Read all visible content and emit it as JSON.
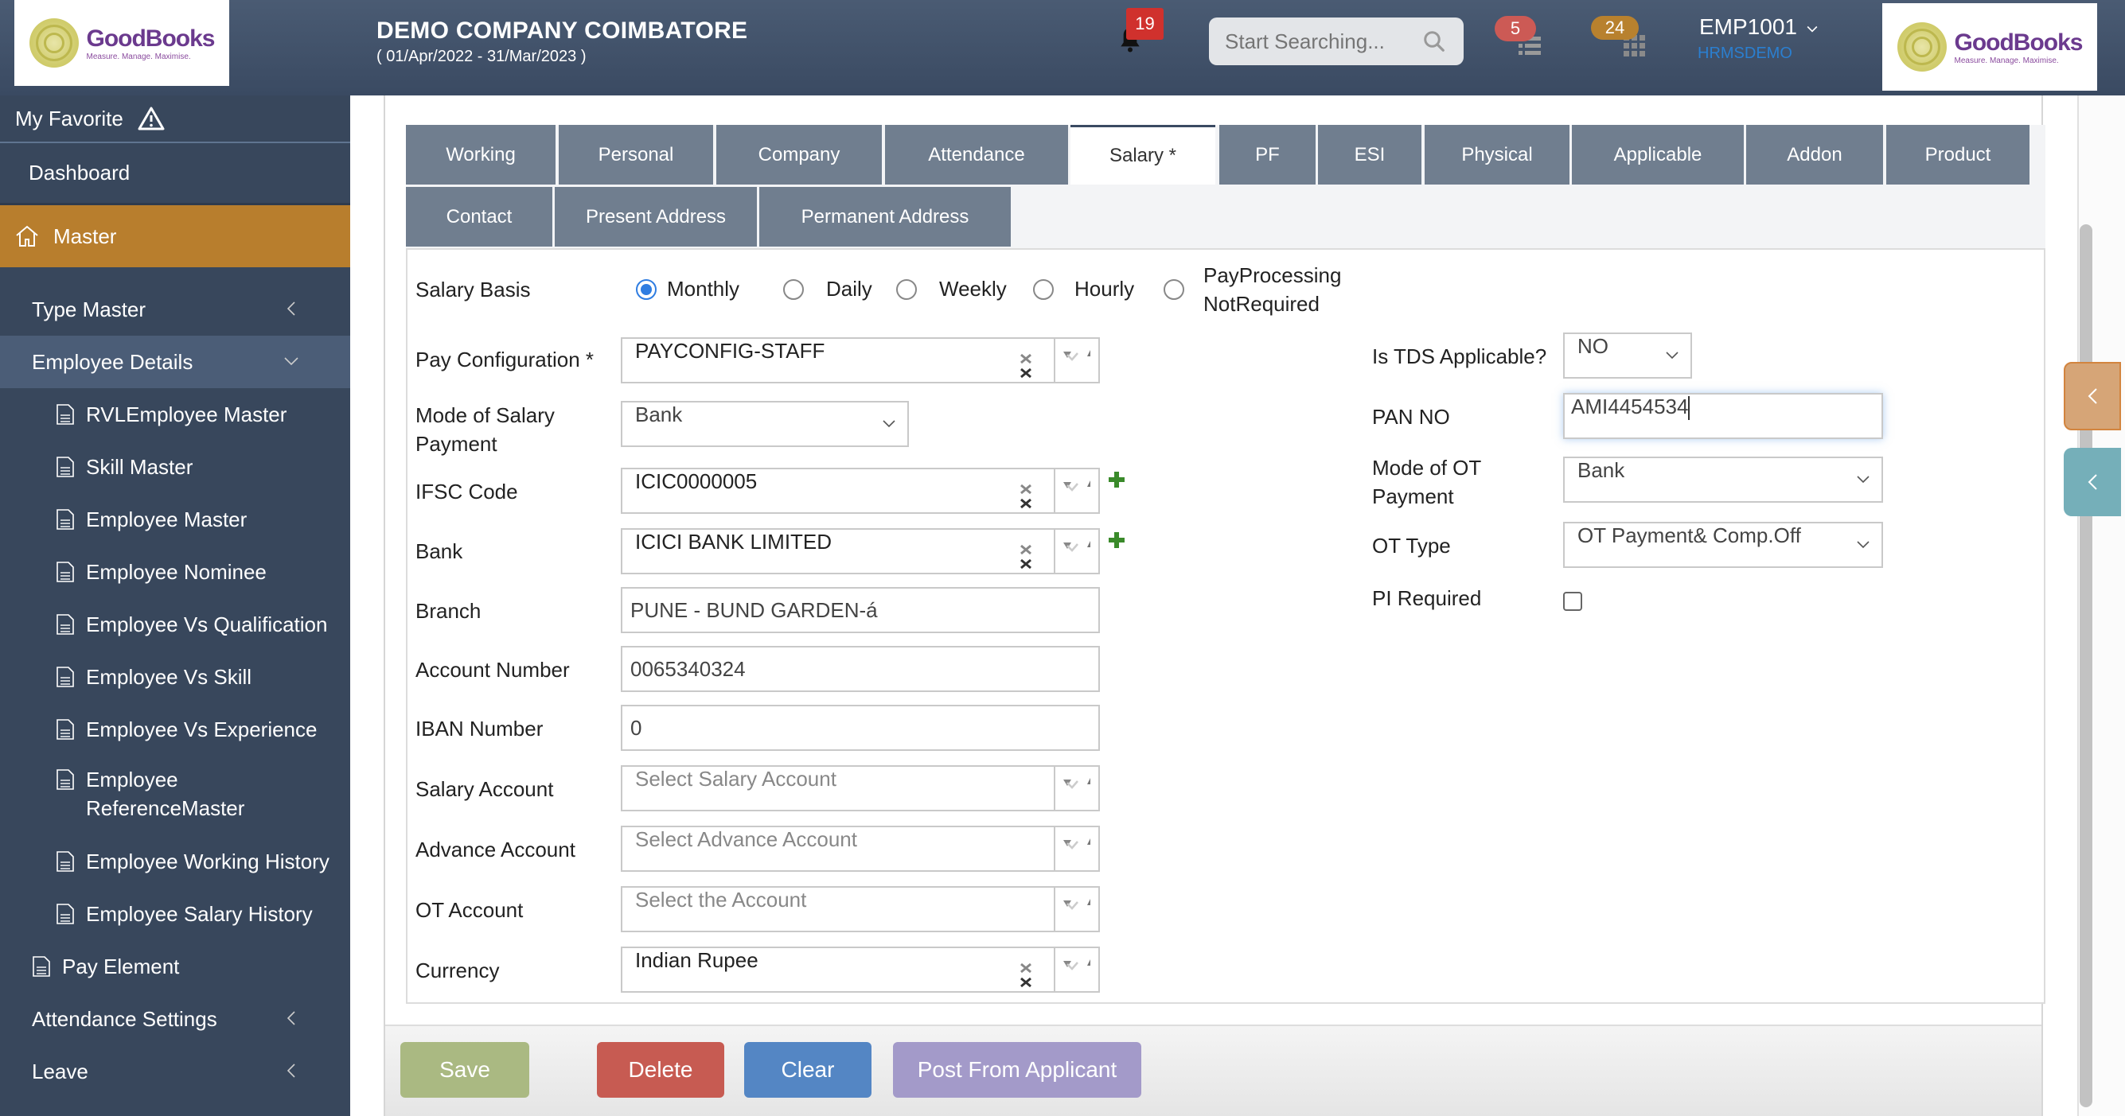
{
  "header": {
    "logo_name": "GoodBooks",
    "logo_tagline": "Measure. Manage. Maximise.",
    "company_name": "DEMO COMPANY COIMBATORE",
    "company_period": "( 01/Apr/2022 - 31/Mar/2023 )",
    "notification_count": "19",
    "search_placeholder": "Start Searching...",
    "tasks_count": "5",
    "apps_count": "24",
    "user_id": "EMP1001",
    "user_sub": "HRMSDEMO"
  },
  "sidebar": {
    "favorite": "My Favorite",
    "dashboard": "Dashboard",
    "master": "Master",
    "groups": [
      {
        "label": "Type Master"
      },
      {
        "label": "Employee Details"
      }
    ],
    "employee_items": [
      {
        "label": "RVLEmployee Master"
      },
      {
        "label": "Skill Master"
      },
      {
        "label": "Employee Master"
      },
      {
        "label": "Employee Nominee"
      },
      {
        "label": "Employee Vs Qualification"
      },
      {
        "label": "Employee Vs Skill"
      },
      {
        "label": "Employee Vs Experience"
      },
      {
        "label": "Employee ReferenceMaster"
      },
      {
        "label": "Employee Working History"
      },
      {
        "label": "Employee Salary History"
      }
    ],
    "pay_element": "Pay Element",
    "attendance_settings": "Attendance Settings",
    "leave": "Leave"
  },
  "tabs": {
    "row1": [
      "Working",
      "Personal",
      "Company",
      "Attendance",
      "Salary *",
      "PF",
      "ESI",
      "Physical",
      "Applicable",
      "Addon",
      "Product"
    ],
    "row2": [
      "Contact",
      "Present Address",
      "Permanent Address"
    ],
    "active": "Salary *"
  },
  "form": {
    "salary_basis": {
      "label": "Salary Basis",
      "options": [
        "Monthly",
        "Daily",
        "Weekly",
        "Hourly",
        "PayProcessing NotRequired"
      ],
      "option_last_line1": "PayProcessing",
      "option_last_line2": "NotRequired",
      "selected": "Monthly"
    },
    "pay_configuration": {
      "label": "Pay Configuration *",
      "value": "PAYCONFIG-STAFF"
    },
    "mode_of_salary_payment": {
      "label_line1": "Mode of Salary",
      "label_line2": "Payment",
      "value": "Bank"
    },
    "ifsc_code": {
      "label": "IFSC Code",
      "value": "ICIC0000005"
    },
    "bank": {
      "label": "Bank",
      "value": "ICICI BANK LIMITED"
    },
    "branch": {
      "label": "Branch",
      "value": "PUNE - BUND GARDEN-á"
    },
    "account_number": {
      "label": "Account Number",
      "value": "0065340324"
    },
    "iban_number": {
      "label": "IBAN Number",
      "value": "0"
    },
    "salary_account": {
      "label": "Salary Account",
      "placeholder": "Select Salary Account"
    },
    "advance_account": {
      "label": "Advance Account",
      "placeholder": "Select Advance Account"
    },
    "ot_account": {
      "label": "OT Account",
      "placeholder": "Select the Account"
    },
    "currency": {
      "label": "Currency",
      "value": "Indian Rupee"
    },
    "is_tds_applicable": {
      "label": "Is TDS Applicable?",
      "value": "NO"
    },
    "pan_no": {
      "label": "PAN NO",
      "value": "AMI4454534"
    },
    "mode_of_ot_payment": {
      "label_line1": "Mode of OT",
      "label_line2": "Payment",
      "value": "Bank"
    },
    "ot_type": {
      "label": "OT Type",
      "value": "OT Payment& Comp.Off"
    },
    "pi_required": {
      "label": "PI Required",
      "checked": false
    }
  },
  "buttons": {
    "save": "Save",
    "delete": "Delete",
    "clear": "Clear",
    "post_from_applicant": "Post From Applicant"
  },
  "colors": {
    "header_bg": "#3f4f67",
    "sidebar_bg": "#38475c",
    "active_menu": "#b87e2d",
    "tab_bg": "#707e8f",
    "save": "#aab982",
    "delete": "#c75b52",
    "clear": "#5486c4",
    "post": "#a39ac9",
    "radio_selected": "#2f7de1",
    "add_icon": "#3a8a2a"
  }
}
